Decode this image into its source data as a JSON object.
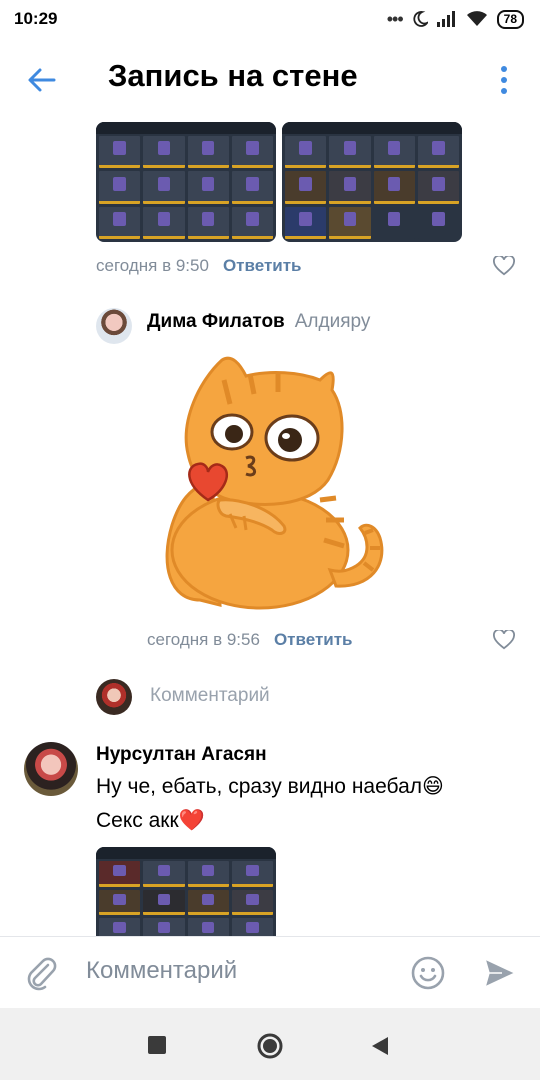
{
  "status_bar": {
    "time": "10:29",
    "battery": "78",
    "icons": [
      "more-dots-icon",
      "moon-icon",
      "signal-icon",
      "wifi-icon",
      "battery-icon"
    ]
  },
  "header": {
    "title": "Запись на стене",
    "back_icon": "arrow-left-icon",
    "menu_icon": "vertical-dots-icon",
    "accent": "#3f8ae0"
  },
  "comments": [
    {
      "timestamp": "сегодня в 9:50",
      "reply_label": "Ответить"
    },
    {
      "author": "Дима Филатов",
      "addressee": "Алдияру",
      "sticker": "peach-cat-kiss-sticker",
      "timestamp": "сегодня в 9:56",
      "reply_label": "Ответить"
    },
    {
      "author": "Нурсултан Агасян",
      "text_line1": "Ну че, ебать, сразу видно наебал😄",
      "text_line2": "Секс акк❤️"
    }
  ],
  "reply_prompt": "Комментарий",
  "composer": {
    "placeholder": "Комментарий",
    "attach_icon": "paperclip-icon",
    "emoji_icon": "smiley-icon",
    "send_icon": "send-icon"
  },
  "colors": {
    "meta_gray": "#818c99",
    "reply_blue": "#5b7fa6",
    "cat_orange": "#f5a540"
  }
}
